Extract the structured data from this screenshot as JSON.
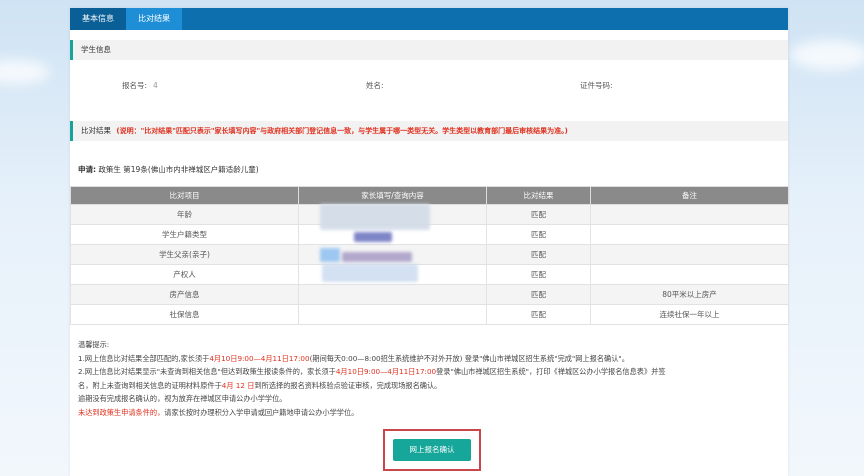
{
  "tabs": [
    "基本信息",
    "比对结果"
  ],
  "student_section": {
    "title": "学生信息",
    "reg_no_label": "报名号:",
    "reg_no_value": "4",
    "name_label": "姓名:",
    "id_label": "证件号码:"
  },
  "compare_section": {
    "title": "比对结果",
    "note": "(说明：\"比对结果\"匹配只表示\"家长填写内容\"与政府相关部门登记信息一致，与学生属于哪一类型无关。学生类型以教育部门最后审核结果为准。)"
  },
  "application": {
    "label": "申请:",
    "value": "政策生 第19条(佛山市内非禅城区户籍适龄儿童)"
  },
  "table": {
    "headers": [
      "比对项目",
      "家长填写/查询内容",
      "比对结果",
      "备注"
    ],
    "rows": [
      {
        "item": "年龄",
        "content": "",
        "result": "匹配",
        "note": ""
      },
      {
        "item": "学生户籍类型",
        "content": "",
        "result": "匹配",
        "note": ""
      },
      {
        "item": "学生父亲(亲子)",
        "content": "",
        "result": "匹配",
        "note": ""
      },
      {
        "item": "产权人",
        "content": "",
        "result": "匹配",
        "note": ""
      },
      {
        "item": "房产信息",
        "content": "",
        "result": "匹配",
        "note": "80平米以上房产"
      },
      {
        "item": "社保信息",
        "content": "",
        "result": "匹配",
        "note": "连续社保一年以上"
      }
    ],
    "result_color": "#2a9a33"
  },
  "tips": {
    "title": "温馨提示:",
    "line1_a": "1.网上信息比对结果全部匹配的,家长须于",
    "line1_red": "4月10日9:00—4月11日17:00",
    "line1_b": "(期间每天0:00—8:00招生系统维护不对外开放) 登录\"佛山市禅城区招生系统\"完成\"网上报名确认\"。",
    "line2_a": "2.网上信息比对结果显示\"未查询到相关信息\"但达到政策生报读条件的，家长须于",
    "line2_red": "4月10日9:00—4月11日17:00",
    "line2_b": "登录\"佛山市禅城区招生系统\"，打印《禅城区公办小学报名信息表》并签",
    "line3_a": "名，附上未查询到相关信息的证明材料原件于",
    "line3_red": "4月 12 日",
    "line3_b": "到所选择的报名资料核验点验证审核，完成现场报名确认。",
    "line4": "逾期没有完成报名确认的，视为放弃在禅城区申请公办小学学位。",
    "line5_red": "未达到政策生申请条件的，",
    "line5_b": "请家长按时办理积分入学申请或回户籍地申请公办小学学位。"
  },
  "confirm_button": "网上报名确认",
  "colors": {
    "tab_bar": "#0d6fad",
    "accent": "#17a39a",
    "red": "#e0301e",
    "button": "#16a79a"
  }
}
